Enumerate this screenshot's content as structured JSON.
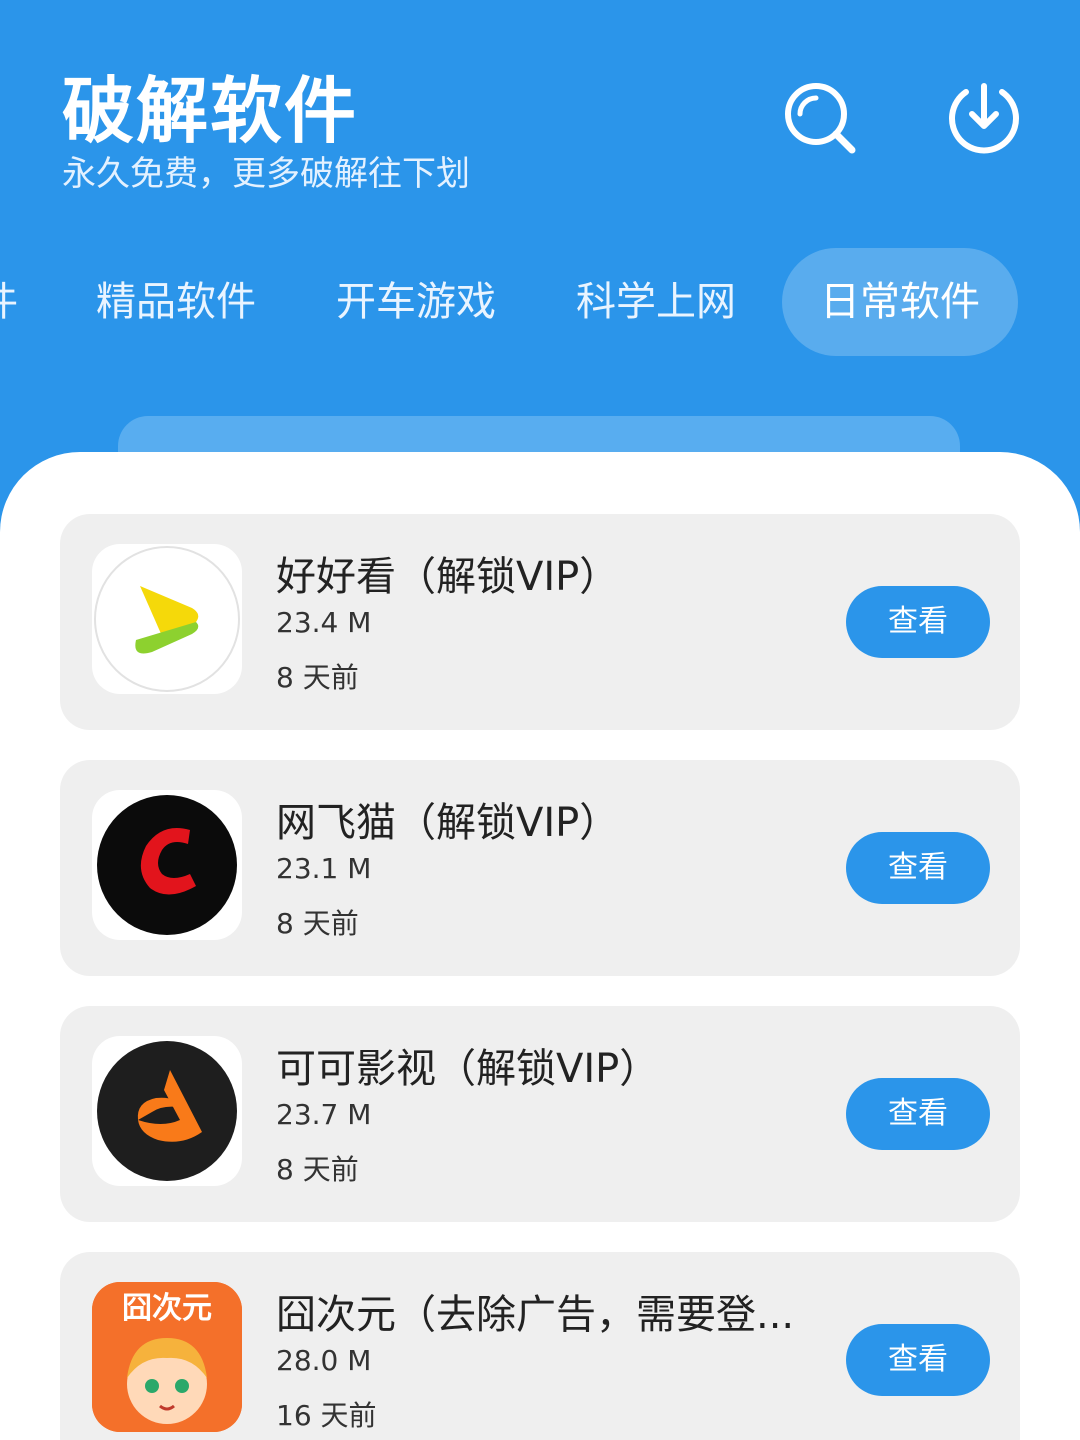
{
  "header": {
    "title": "破解软件",
    "subtitle": "永久免费，更多破解往下划",
    "search_icon": "search-icon",
    "download_icon": "download-icon",
    "accent_color": "#2b95ea"
  },
  "tabs": [
    {
      "label": "件",
      "active": false
    },
    {
      "label": "精品软件",
      "active": false
    },
    {
      "label": "开车游戏",
      "active": false
    },
    {
      "label": "科学上网",
      "active": false
    },
    {
      "label": "日常软件",
      "active": true
    }
  ],
  "apps": [
    {
      "name": "好好看（解锁VIP）",
      "size": "23.4 M",
      "date": "8 天前",
      "button": "查看",
      "icon": "play-logo-icon"
    },
    {
      "name": "网飞猫（解锁VIP）",
      "size": "23.1 M",
      "date": "8 天前",
      "button": "查看",
      "icon": "netflix-cat-logo-icon"
    },
    {
      "name": "可可影视（解锁VIP）",
      "size": "23.7 M",
      "date": "8 天前",
      "button": "查看",
      "icon": "keke-logo-icon"
    },
    {
      "name": "囧次元（去除广告，需要登...",
      "size": "28.0 M",
      "date": "16 天前",
      "button": "查看",
      "icon": "jiongciyuan-logo-icon",
      "icon_text": "囧次元"
    }
  ]
}
